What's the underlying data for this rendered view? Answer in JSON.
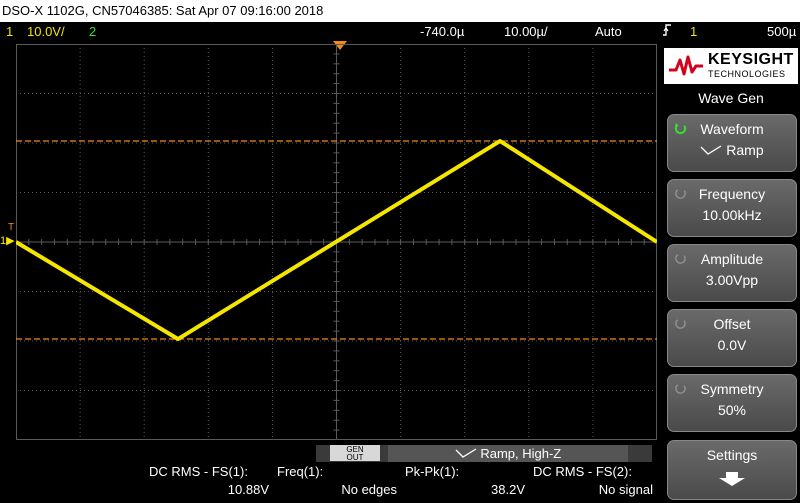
{
  "title": "DSO-X 1102G, CN57046385: Sat Apr 07 09:16:00 2018",
  "status": {
    "ch1_num": "1",
    "ch1_scale": "10.0V/",
    "ch2_num": "2",
    "trigger_pos": "-740.0µ",
    "timebase": "10.00µ/",
    "trigger_mode": "Auto",
    "trigger_icon": "rising-edge-icon",
    "trigger_source": "1",
    "trigger_level": "500µ"
  },
  "colors": {
    "ch1": "#f5e600",
    "ch2": "#3adb3a",
    "marker": "#f08a1a",
    "grid": "#5a5a5a"
  },
  "markers": {
    "ch1": "1",
    "trigger": "T"
  },
  "waveform": {
    "shape": "ramp",
    "cursor_top_level": 0.245,
    "cursor_bottom_level": 0.745
  },
  "gen_status": {
    "gen_out": "GEN\nOUT",
    "label": "Ramp, High-Z"
  },
  "measurements": [
    {
      "label": "DC RMS - FS(1):",
      "value": "10.88V"
    },
    {
      "label": "Freq(1):",
      "value": "No edges"
    },
    {
      "label": "Pk-Pk(1):",
      "value": "38.2V"
    },
    {
      "label": "DC RMS - FS(2):",
      "value": "No signal"
    }
  ],
  "sidebar": {
    "brand": "KEYSIGHT",
    "brand_sub": "TECHNOLOGIES",
    "menu_title": "Wave Gen",
    "softkeys": [
      {
        "title": "Waveform",
        "value": "Ramp"
      },
      {
        "title": "Frequency",
        "value": "10.00kHz"
      },
      {
        "title": "Amplitude",
        "value": "3.00Vpp"
      },
      {
        "title": "Offset",
        "value": "0.0V"
      },
      {
        "title": "Symmetry",
        "value": "50%"
      },
      {
        "title": "Settings",
        "value": ""
      }
    ]
  }
}
